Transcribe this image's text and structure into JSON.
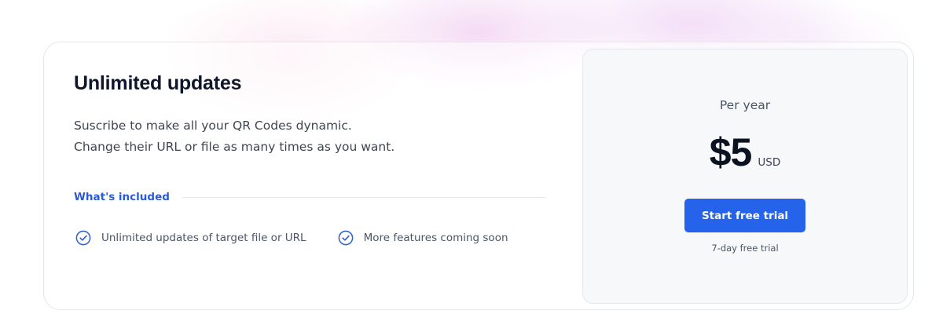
{
  "plan": {
    "title": "Unlimited updates",
    "description": [
      "Suscribe to make all your QR Codes dynamic.",
      "Change their URL or file as many times as you want."
    ],
    "included_label": "What's included",
    "features": [
      {
        "label": "Unlimited updates of target file or URL",
        "icon": "check-circle-icon"
      },
      {
        "label": "More features coming soon",
        "icon": "check-circle-icon"
      }
    ]
  },
  "pricing": {
    "period": "Per year",
    "price": "$5",
    "currency": "USD",
    "cta_label": "Start free trial",
    "trial_note": "7-day free trial"
  },
  "colors": {
    "accent": "#2563eb",
    "label_blue": "#2a5bd7",
    "check_icon": "#2f5fc9"
  }
}
